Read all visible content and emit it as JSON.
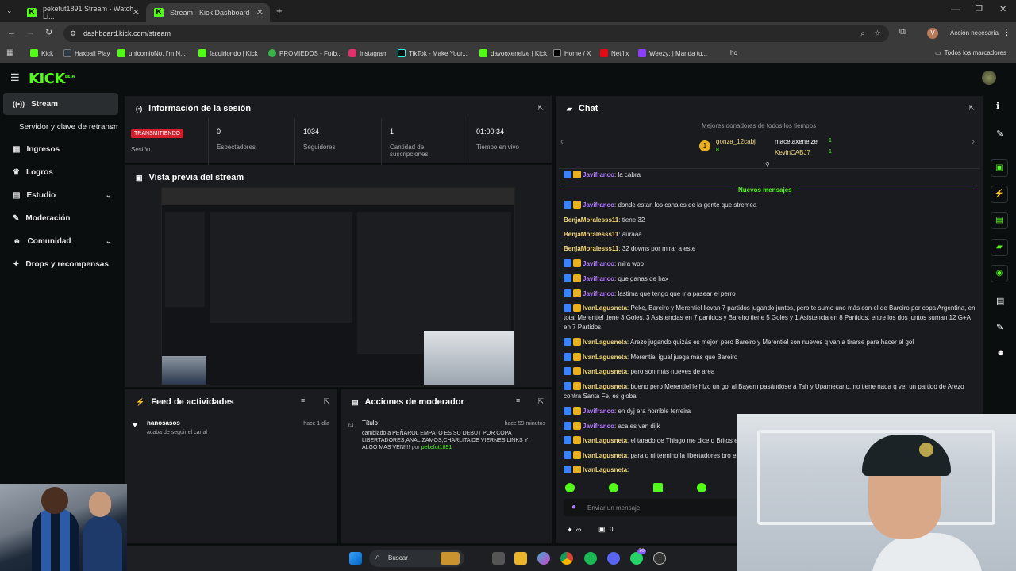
{
  "browser": {
    "tabs": [
      {
        "title": "pekefut1891 Stream - Watch Li...",
        "active": false
      },
      {
        "title": "Stream - Kick Dashboard",
        "active": true
      }
    ],
    "url": "dashboard.kick.com/stream",
    "action_label": "Acción necesaria",
    "profile_initial": "V",
    "bookmarks": [
      "Kick",
      "Haxball Play",
      "unicomioNo, I'm N...",
      "facuiriondo | Kick",
      "PROMIEDOS - Futb...",
      "Instagram",
      "TikTok - Make Your...",
      "davooxeneize | Kick",
      "Home / X",
      "Netflix",
      "Weezy: | Manda tu...",
      "ho"
    ],
    "bookmarks_folder": "Todos los marcadores"
  },
  "kick": {
    "logo": "KICK",
    "logo_sup": "BETA"
  },
  "sidebar": {
    "items": [
      {
        "label": "Stream",
        "active": true
      },
      {
        "label": "Servidor y clave de retransmisión",
        "active": false
      },
      {
        "label": "Ingresos"
      },
      {
        "label": "Logros"
      },
      {
        "label": "Estudio"
      },
      {
        "label": "Moderación"
      },
      {
        "label": "Comunidad"
      },
      {
        "label": "Drops y recompensas"
      }
    ]
  },
  "session": {
    "title": "Información de la sesión",
    "live_badge": "TRANSMITIENDO",
    "session_label": "Sesión",
    "stats": [
      {
        "value": "0",
        "label": "Espectadores"
      },
      {
        "value": "1034",
        "label": "Seguidores"
      },
      {
        "value": "1",
        "label": "Cantidad de suscripciones"
      },
      {
        "value": "01:00:34",
        "label": "Tiempo en vivo"
      }
    ]
  },
  "preview": {
    "title": "Vista previa del stream"
  },
  "feed": {
    "title": "Feed de actividades",
    "items": [
      {
        "user": "nanosasos",
        "text": "acaba de seguir el canal",
        "time": "hace 1 día"
      }
    ]
  },
  "modactions": {
    "title": "Acciones de moderador",
    "items": [
      {
        "heading": "Título",
        "time": "hace 59 minutos",
        "text": "cambiado a PEÑAROL EMPATO ES SU DEBUT POR COPA LIBERTADORES,ANALIZAMOS,CHARLITA DE VIERNES,LINKS Y ALGO MAS VEN!!!!",
        "by": "por",
        "user": "pekefut1891"
      }
    ]
  },
  "chat": {
    "title": "Chat",
    "top_donors_label": "Mejores donadores de todos los tiempos",
    "donors": [
      {
        "name": "gonza_12cabj",
        "amount": "8"
      },
      {
        "name": "macetaxeneize",
        "amount": "1"
      },
      {
        "name": "KevinCABJ7",
        "amount": "1"
      }
    ],
    "new_messages_label": "Nuevos mensajes",
    "messages": [
      {
        "user": "Javifranco",
        "text": "la cabra",
        "color": "#b57bff"
      },
      {
        "user": "Javifranco",
        "text": "donde estan los canales de la gente que stremea",
        "color": "#b57bff"
      },
      {
        "user": "BenjaMoralesss11",
        "text": "tiene 32",
        "color": "#f5d87a"
      },
      {
        "user": "BenjaMoralesss11",
        "text": "auraaa",
        "color": "#f5d87a"
      },
      {
        "user": "BenjaMoralesss11",
        "text": "32 downs por mirar a este",
        "color": "#f5d87a"
      },
      {
        "user": "Javifranco",
        "text": "mira wpp",
        "color": "#b57bff"
      },
      {
        "user": "Javifranco",
        "text": "que ganas de hax",
        "color": "#b57bff"
      },
      {
        "user": "Javifranco",
        "text": "lastima que tengo que ir a pasear el perro",
        "color": "#b57bff"
      },
      {
        "user": "IvanLagusneta",
        "text": "Peke, Bareiro y Merentiel llevan 7 partidos jugando juntos, pero te sumo uno más con el de Bareiro por copa Argentina, en total Merentiel tiene 3 Goles, 3 Asistencias en 7 partidos y Bareiro tiene 5 Goles y 1 Asistencia en 8 Partidos, entre los dos juntos suman 12 G+A en 7 Partidos.",
        "color": "#f5d87a"
      },
      {
        "user": "IvanLagusneta",
        "text": "Arezo jugando quizás es mejor, pero Bareiro y Merentiel son nueves q van a tirarse para hacer el gol",
        "color": "#f5d87a"
      },
      {
        "user": "IvanLagusneta",
        "text": "Merentiel igual juega más que Bareiro",
        "color": "#f5d87a"
      },
      {
        "user": "IvanLagusneta",
        "text": "pero son más nueves de area",
        "color": "#f5d87a"
      },
      {
        "user": "IvanLagusneta",
        "text": "bueno pero Merentiel le hizo un gol al Bayern pasándose a Tah y Upamecano, no tiene nada q ver un partido de Arezo contra Santa Fe, es global",
        "color": "#f5d87a"
      },
      {
        "user": "Javifranco",
        "text": "en dyj era horrible ferreira",
        "color": "#b57bff"
      },
      {
        "user": "Javifranco",
        "text": "aca es van dijk",
        "color": "#b57bff"
      },
      {
        "user": "IvanLagusneta",
        "text": "el tarado de Thiago me dice q Britos e",
        "color": "#f5d87a"
      },
      {
        "user": "IvanLagusneta",
        "text": "para q ni termino la libertadores bro el",
        "color": "#f5d87a"
      },
      {
        "user": "IvanLagusneta",
        "text": "",
        "color": "#f5d87a"
      }
    ],
    "input_placeholder": "Enviar un mensaje",
    "infinity": "∞",
    "count": "0"
  },
  "taskbar": {
    "search_label": "Buscar",
    "badge": "70"
  },
  "colors": {
    "accent": "#53fc18",
    "panel": "#191b1f",
    "bg": "#0b0e0f",
    "live": "#d61f2c"
  }
}
